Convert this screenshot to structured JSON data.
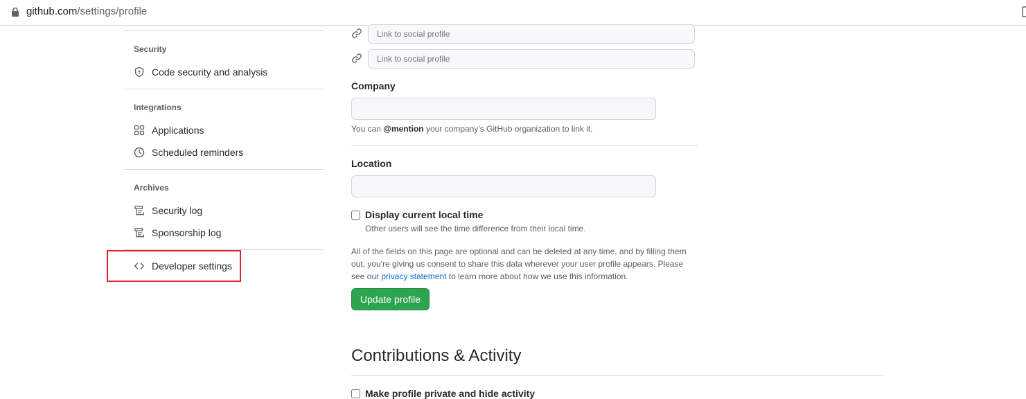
{
  "browser": {
    "url_host": "github.com",
    "url_path": "/settings/profile"
  },
  "sidebar": {
    "sections": [
      {
        "heading": "Security",
        "items": [
          {
            "label": "Code security and analysis",
            "icon": "shield-icon"
          }
        ]
      },
      {
        "heading": "Integrations",
        "items": [
          {
            "label": "Applications",
            "icon": "apps-icon"
          },
          {
            "label": "Scheduled reminders",
            "icon": "clock-icon"
          }
        ]
      },
      {
        "heading": "Archives",
        "items": [
          {
            "label": "Security log",
            "icon": "log-icon"
          },
          {
            "label": "Sponsorship log",
            "icon": "log-icon"
          }
        ]
      },
      {
        "heading": "",
        "items": [
          {
            "label": "Developer settings",
            "icon": "code-icon"
          }
        ]
      }
    ]
  },
  "profile": {
    "social_placeholder": "Link to social profile",
    "company": {
      "label": "Company",
      "value": "",
      "note_prefix": "You can ",
      "note_mention": "@mention",
      "note_suffix": " your company’s GitHub organization to link it."
    },
    "location": {
      "label": "Location",
      "value": ""
    },
    "local_time": {
      "label": "Display current local time",
      "checked": false,
      "note": "Other users will see the time difference from their local time."
    },
    "disclaimer": {
      "before": "All of the fields on this page are optional and can be deleted at any time, and by filling them out, you're giving us consent to share this data wherever your user profile appears. Please see our ",
      "link": "privacy statement",
      "after": " to learn more about how we use this information."
    },
    "update_button": "Update profile"
  },
  "contributions": {
    "title": "Contributions & Activity",
    "private_label": "Make profile private and hide activity",
    "private_checked": false
  },
  "colors": {
    "primary_button": "#2da44e",
    "link": "#0969da",
    "highlight_box": "#e5202b"
  }
}
